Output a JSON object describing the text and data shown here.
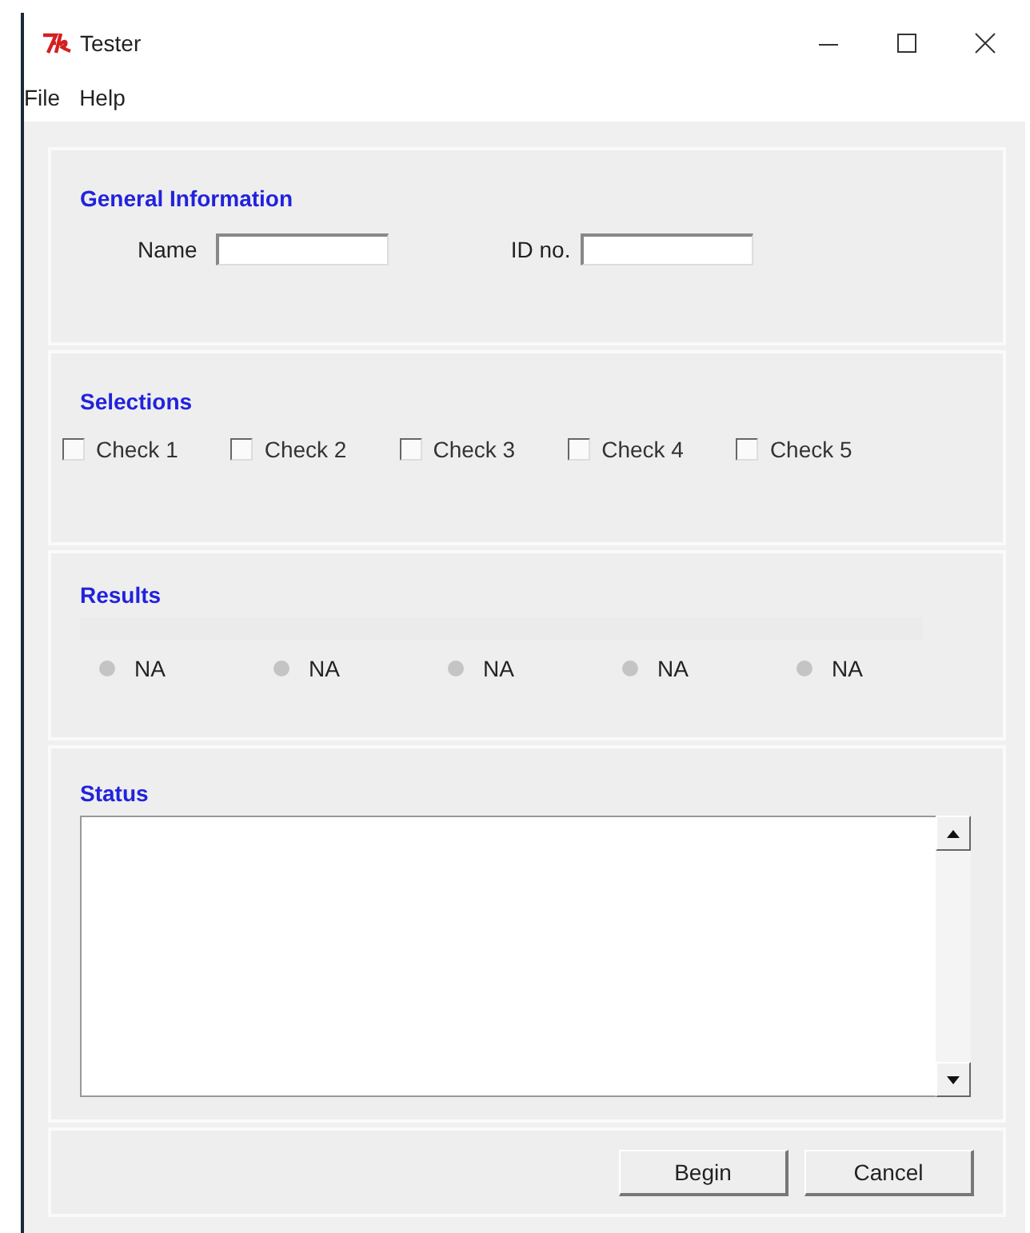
{
  "window": {
    "title": "Tester"
  },
  "menu": [
    "File",
    "Help"
  ],
  "general": {
    "title": "General Information",
    "fields": [
      {
        "label": "Name"
      },
      {
        "label": "ID no."
      }
    ]
  },
  "selections": {
    "title": "Selections",
    "checks": [
      {
        "label": "Check 1",
        "checked": false
      },
      {
        "label": "Check 2",
        "checked": false
      },
      {
        "label": "Check 3",
        "checked": false
      },
      {
        "label": "Check 4",
        "checked": false
      },
      {
        "label": "Check 5",
        "checked": false
      }
    ]
  },
  "results": {
    "title": "Results",
    "items": [
      {
        "label": "NA",
        "color": "#c4c4c4"
      },
      {
        "label": "NA",
        "color": "#c4c4c4"
      },
      {
        "label": "NA",
        "color": "#c4c4c4"
      },
      {
        "label": "NA",
        "color": "#c4c4c4"
      },
      {
        "label": "NA",
        "color": "#c4c4c4"
      }
    ]
  },
  "status": {
    "title": "Status"
  },
  "buttons": [
    "Begin",
    "Cancel"
  ]
}
